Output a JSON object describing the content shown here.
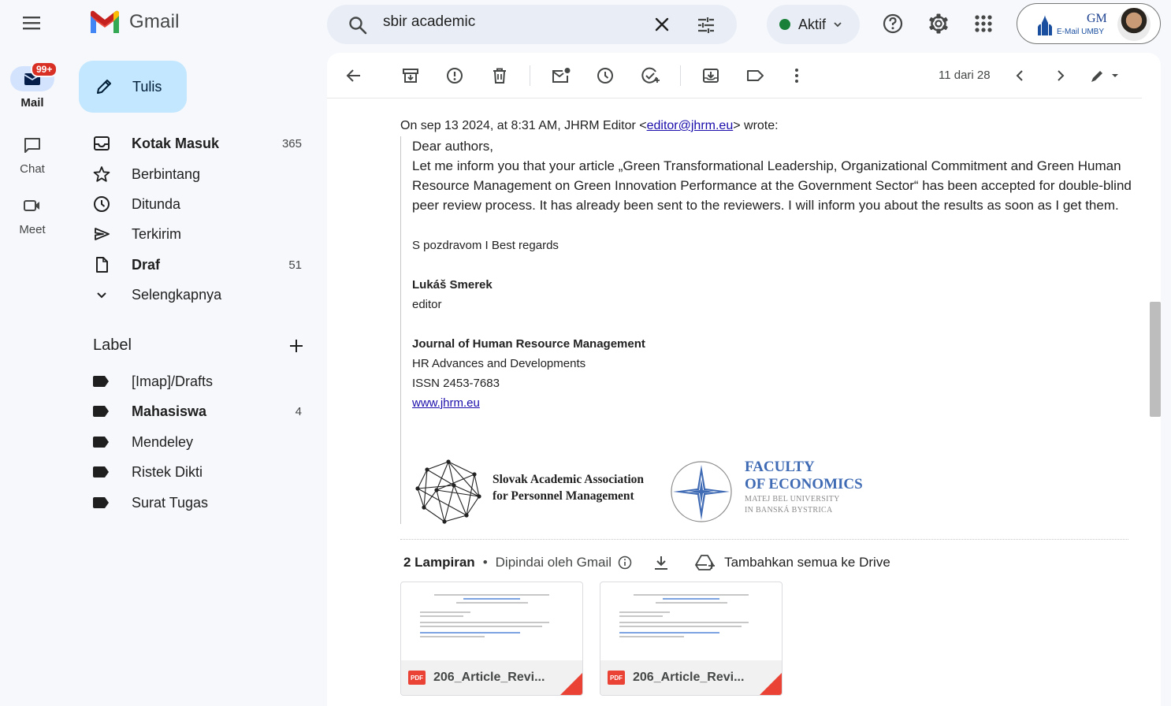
{
  "app": {
    "name": "Gmail",
    "search_query": "sbir academic",
    "status": "Aktif",
    "account_brand_top": "GM",
    "account_brand_bottom": "E-Mail UMBY"
  },
  "rail": {
    "mail_label": "Mail",
    "mail_badge": "99+",
    "chat_label": "Chat",
    "meet_label": "Meet"
  },
  "compose_label": "Tulis",
  "nav": [
    {
      "label": "Kotak Masuk",
      "count": "365",
      "icon": "inbox-icon",
      "bold": true
    },
    {
      "label": "Berbintang",
      "count": "",
      "icon": "star-icon",
      "bold": false
    },
    {
      "label": "Ditunda",
      "count": "",
      "icon": "clock-icon",
      "bold": false
    },
    {
      "label": "Terkirim",
      "count": "",
      "icon": "send-icon",
      "bold": false
    },
    {
      "label": "Draf",
      "count": "51",
      "icon": "draft-icon",
      "bold": true
    },
    {
      "label": "Selengkapnya",
      "count": "",
      "icon": "chevron-down-icon",
      "bold": false
    }
  ],
  "labels_header": "Label",
  "labels": [
    {
      "label": "[Imap]/Drafts",
      "count": "",
      "bold": false
    },
    {
      "label": "Mahasiswa",
      "count": "4",
      "bold": true
    },
    {
      "label": "Mendeley",
      "count": "",
      "bold": false
    },
    {
      "label": "Ristek Dikti",
      "count": "",
      "bold": false
    },
    {
      "label": "Surat Tugas",
      "count": "",
      "bold": false
    }
  ],
  "toolbar": {
    "pager": "11 dari 28"
  },
  "email": {
    "quote_prefix": "On sep 13 2024, at 8:31 AM, JHRM Editor <",
    "quote_email": "editor@jhrm.eu",
    "quote_suffix": "> wrote:",
    "greeting": "Dear authors,",
    "body": "Let me inform you that your article „Green Transformational Leadership, Organizational Commitment and Green Human Resource Management on Green Innovation Performance at the Government Sector“ has been accepted for double-blind peer review process. It has already been sent to the reviewers. I will inform you about the results as soon as I get them.",
    "regards": "S pozdravom I Best regards",
    "sig_name": "Lukáš Smerek",
    "sig_role": "editor",
    "journal": "Journal of Human Resource Management",
    "journal_sub": "HR Advances and Developments",
    "issn": "ISSN 2453-7683",
    "website": "www.jhrm.eu",
    "logo1_line1": "Slovak Academic Association",
    "logo1_line2": "for Personnel Management",
    "logo2_line1": "FACULTY",
    "logo2_line2": "OF ECONOMICS",
    "logo2_line3": "MATEJ BEL UNIVERSITY",
    "logo2_line4": "IN BANSKÁ BYSTRICA"
  },
  "attachments": {
    "count_label": "2 Lampiran",
    "scanned_label": "Dipindai oleh Gmail",
    "drive_label": "Tambahkan semua ke Drive",
    "files": [
      {
        "name": "206_Article_Revi..."
      },
      {
        "name": "206_Article_Revi..."
      }
    ]
  },
  "colors": {
    "accent": "#c2e7ff",
    "badge": "#d93025",
    "status_green": "#188038",
    "link": "#1a0dab",
    "pdf_red": "#ea4335"
  }
}
